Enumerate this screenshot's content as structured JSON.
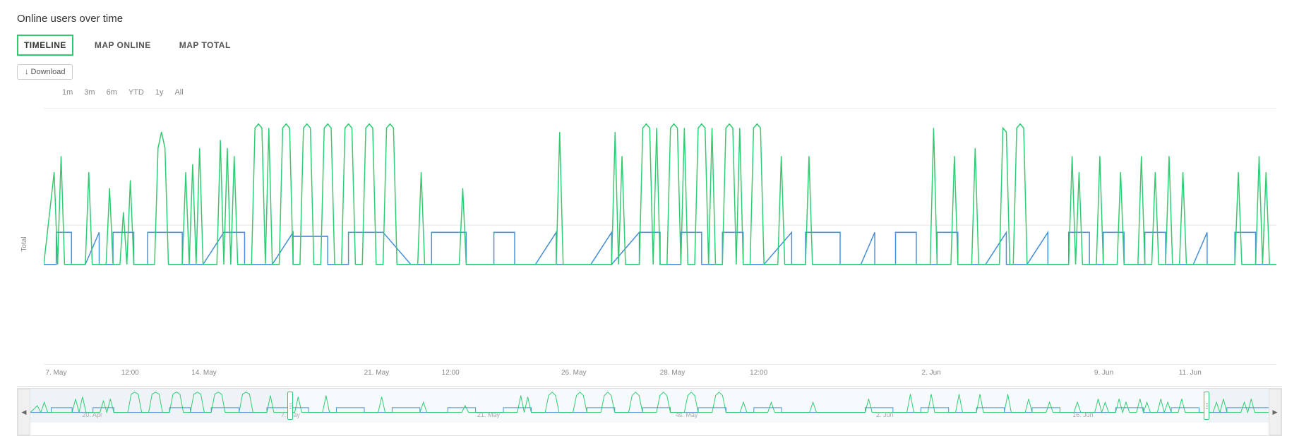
{
  "header": {
    "title": "Online users over time"
  },
  "tabs": [
    {
      "id": "timeline",
      "label": "TIMELINE",
      "active": true
    },
    {
      "id": "map-online",
      "label": "MAP ONLINE",
      "active": false
    },
    {
      "id": "map-total",
      "label": "MAP TOTAL",
      "active": false
    }
  ],
  "toolbar": {
    "download_label": "↓ Download"
  },
  "time_filters": [
    {
      "id": "1m",
      "label": "1m"
    },
    {
      "id": "3m",
      "label": "3m"
    },
    {
      "id": "6m",
      "label": "6m"
    },
    {
      "id": "ytd",
      "label": "YTD"
    },
    {
      "id": "1y",
      "label": "1y"
    },
    {
      "id": "all",
      "label": "All"
    }
  ],
  "chart": {
    "y_axis_label": "Total",
    "y_ticks": [
      {
        "value": "0",
        "pct": 0
      },
      {
        "value": "2",
        "pct": 55
      }
    ],
    "x_ticks": [
      {
        "label": "7. May",
        "pct": 1
      },
      {
        "label": "12:00",
        "pct": 7
      },
      {
        "label": "14. May",
        "pct": 13
      },
      {
        "label": "21. May",
        "pct": 27
      },
      {
        "label": "12:00",
        "pct": 33
      },
      {
        "label": "26. May",
        "pct": 43
      },
      {
        "label": "28. May",
        "pct": 51
      },
      {
        "label": "12:00",
        "pct": 58
      },
      {
        "label": "2. Jun",
        "pct": 72
      },
      {
        "label": "9. Jun",
        "pct": 86
      },
      {
        "label": "11. Jun",
        "pct": 93
      }
    ]
  },
  "navigator": {
    "x_ticks": [
      {
        "label": "20. Apr",
        "pct": 5
      },
      {
        "label": "7. May",
        "pct": 21
      },
      {
        "label": "21. May",
        "pct": 37
      },
      {
        "label": "4s. May",
        "pct": 53
      },
      {
        "label": "2. Jun",
        "pct": 69
      },
      {
        "label": "16. Jun",
        "pct": 85
      }
    ],
    "selection_start_pct": 21,
    "selection_end_pct": 95,
    "left_handle_pct": 21,
    "right_handle_pct": 95
  },
  "colors": {
    "blue_line": "#4a90d9",
    "green_line": "#2ecc71",
    "tab_active_border": "#2ecc71",
    "grid_line": "#e8e8e8",
    "accent": "#2ecc71"
  }
}
